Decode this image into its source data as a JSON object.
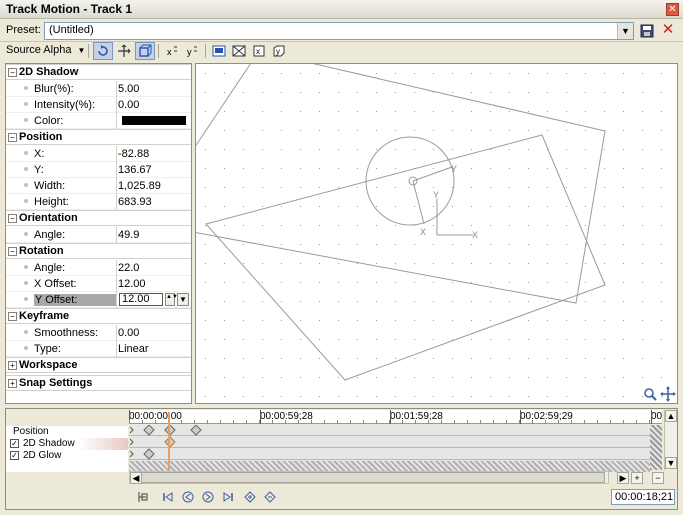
{
  "window": {
    "title": "Track Motion - Track 1"
  },
  "preset": {
    "label": "Preset:",
    "value": "(Untitled)"
  },
  "toolbar": {
    "source_alpha_label": "Source Alpha"
  },
  "properties": {
    "groups": [
      {
        "name": "2D Shadow",
        "rows": [
          {
            "key": "Blur(%):",
            "value": "5.00"
          },
          {
            "key": "Intensity(%):",
            "value": "0.00"
          },
          {
            "key": "Color:",
            "value": ""
          }
        ]
      },
      {
        "name": "Position",
        "rows": [
          {
            "key": "X:",
            "value": "-82.88"
          },
          {
            "key": "Y:",
            "value": "136.67"
          },
          {
            "key": "Width:",
            "value": "1,025.89"
          },
          {
            "key": "Height:",
            "value": "683.93"
          }
        ]
      },
      {
        "name": "Orientation",
        "rows": [
          {
            "key": "Angle:",
            "value": "49.9"
          }
        ]
      },
      {
        "name": "Rotation",
        "rows": [
          {
            "key": "Angle:",
            "value": "22.0"
          },
          {
            "key": "X Offset:",
            "value": "12.00"
          },
          {
            "key": "Y Offset:",
            "value": "12.00"
          }
        ]
      },
      {
        "name": "Keyframe",
        "rows": [
          {
            "key": "Smoothness:",
            "value": "0.00"
          },
          {
            "key": "Type:",
            "value": "Linear"
          }
        ]
      },
      {
        "name": "Workspace",
        "rows": []
      },
      {
        "name": "Snap Settings",
        "rows": []
      }
    ],
    "shadow_color_hex": "#000000"
  },
  "canvas": {
    "axis_x_label": "X",
    "axis_y_label": "Y",
    "origin_x_label": "X",
    "origin_y_label": "Y"
  },
  "timeline": {
    "ruler_labels": [
      "00:00:00;00",
      "00:00:59;28",
      "00:01:59;28",
      "00:02:59;29",
      "00"
    ],
    "tracks": [
      {
        "name": "Position",
        "checked": false
      },
      {
        "name": "2D Shadow",
        "checked": true
      },
      {
        "name": "2D Glow",
        "checked": true
      }
    ],
    "timecode": "00:00:18;21"
  },
  "colors": {
    "accent": "#7c95bd",
    "cursor": "#e8a060",
    "delete": "#cc2222"
  }
}
